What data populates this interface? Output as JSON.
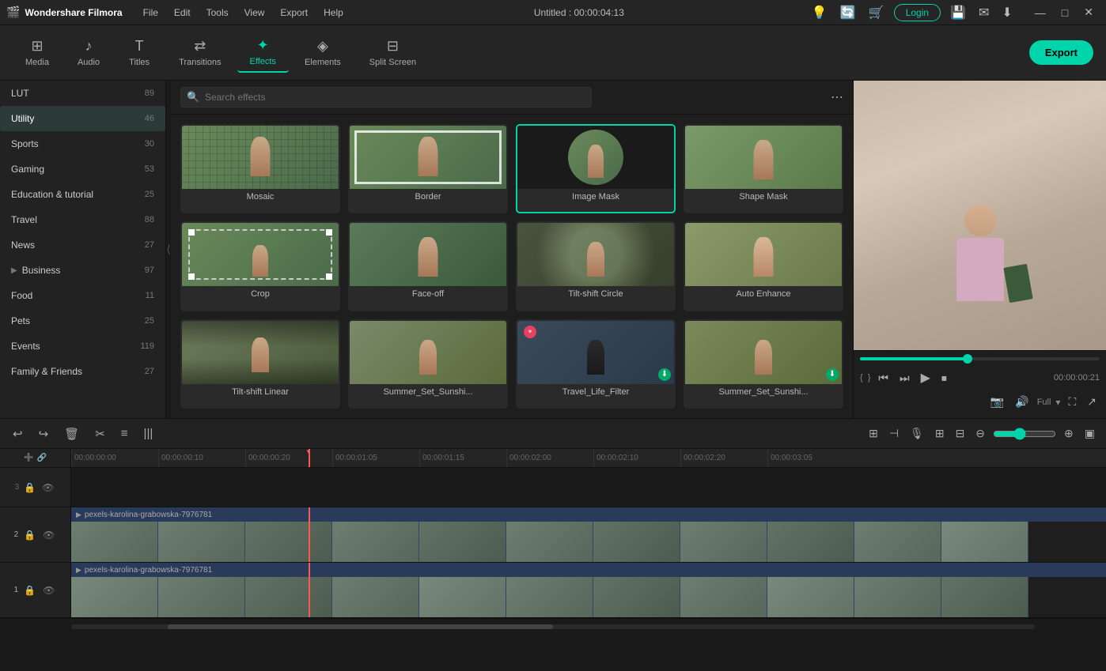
{
  "app": {
    "name": "Wondershare Filmora",
    "title": "Untitled : 00:00:04:13"
  },
  "titlebar": {
    "menus": [
      "File",
      "Edit",
      "Tools",
      "View",
      "Export",
      "Help"
    ],
    "login_label": "Login",
    "win_controls": [
      "—",
      "□",
      "✕"
    ]
  },
  "toolbar": {
    "items": [
      {
        "id": "media",
        "icon": "☰",
        "label": "Media"
      },
      {
        "id": "audio",
        "icon": "♪",
        "label": "Audio"
      },
      {
        "id": "titles",
        "icon": "T",
        "label": "Titles"
      },
      {
        "id": "transitions",
        "icon": "⇄",
        "label": "Transitions"
      },
      {
        "id": "effects",
        "icon": "✦",
        "label": "Effects"
      },
      {
        "id": "elements",
        "icon": "◈",
        "label": "Elements"
      },
      {
        "id": "split_screen",
        "icon": "⊟",
        "label": "Split Screen"
      }
    ],
    "active": "effects",
    "export_label": "Export"
  },
  "sidebar": {
    "items": [
      {
        "id": "lut",
        "label": "LUT",
        "count": 89,
        "expand": false
      },
      {
        "id": "utility",
        "label": "Utility",
        "count": 46,
        "expand": false,
        "active": true
      },
      {
        "id": "sports",
        "label": "Sports",
        "count": 30,
        "expand": false
      },
      {
        "id": "gaming",
        "label": "Gaming",
        "count": 53,
        "expand": false
      },
      {
        "id": "education",
        "label": "Education & tutorial",
        "count": 25,
        "expand": false
      },
      {
        "id": "travel",
        "label": "Travel",
        "count": 88,
        "expand": false
      },
      {
        "id": "news",
        "label": "News",
        "count": 27,
        "expand": false
      },
      {
        "id": "business",
        "label": "Business",
        "count": 97,
        "expand": true
      },
      {
        "id": "food",
        "label": "Food",
        "count": 11,
        "expand": false
      },
      {
        "id": "pets",
        "label": "Pets",
        "count": 25,
        "expand": false
      },
      {
        "id": "events",
        "label": "Events",
        "count": 119,
        "expand": false
      },
      {
        "id": "family",
        "label": "Family & Friends",
        "count": 27,
        "expand": false
      }
    ]
  },
  "effects_panel": {
    "search_placeholder": "Search effects",
    "effects": [
      {
        "id": "mosaic",
        "label": "Mosaic",
        "selected": false,
        "style": "mosaic"
      },
      {
        "id": "border",
        "label": "Border",
        "selected": false,
        "style": "border"
      },
      {
        "id": "image_mask",
        "label": "Image Mask",
        "selected": true,
        "style": "imagemask"
      },
      {
        "id": "shape_mask",
        "label": "Shape Mask",
        "selected": false,
        "style": "shapemask"
      },
      {
        "id": "crop",
        "label": "Crop",
        "selected": false,
        "style": "crop"
      },
      {
        "id": "face_off",
        "label": "Face-off",
        "selected": false,
        "style": "faceoff"
      },
      {
        "id": "tilt_circle",
        "label": "Tilt-shift Circle",
        "selected": false,
        "style": "tiltcircle"
      },
      {
        "id": "auto_enhance",
        "label": "Auto Enhance",
        "selected": false,
        "style": "autoenhance"
      },
      {
        "id": "tilt_linear",
        "label": "Tilt-shift Linear",
        "selected": false,
        "style": "tiltlinear"
      },
      {
        "id": "summer1",
        "label": "Summer_Set_Sunshi...",
        "selected": false,
        "style": "vid-bg"
      },
      {
        "id": "travel_life",
        "label": "Travel_Life_Filter",
        "selected": false,
        "style": "vid-bg-2",
        "download": true
      },
      {
        "id": "summer2",
        "label": "Summer_Set_Sunshi...",
        "selected": false,
        "style": "vid-bg",
        "download": true
      }
    ]
  },
  "preview": {
    "time_current": "00:00:00:21",
    "time_start": "{",
    "time_end": "}",
    "zoom_level": "Full",
    "progress_pct": 45,
    "buttons": [
      "⏮",
      "⏭",
      "▶",
      "⏹"
    ]
  },
  "timeline": {
    "current_time": "00:00:20",
    "marks": [
      "00:00:00:00",
      "00:00:00:10",
      "00:00:00:20",
      "00:00:01:05",
      "00:00:01:15",
      "00:00:02:00",
      "00:00:02:10",
      "00:00:02:20",
      "00:00:03:05"
    ],
    "tracks": [
      {
        "num": 3,
        "label": "",
        "clip_file": ""
      },
      {
        "num": 2,
        "label": "pexels-karolina-grabowska-7976781",
        "clip_file": "pexels-karolina-grabowska-7976781"
      },
      {
        "num": 1,
        "label": "pexels-karolina-grabowska-7976781",
        "clip_file": "pexels-karolina-grabowska-7976781"
      }
    ],
    "tools": [
      "↩",
      "↪",
      "🗑",
      "✂",
      "≡",
      "|||"
    ]
  }
}
